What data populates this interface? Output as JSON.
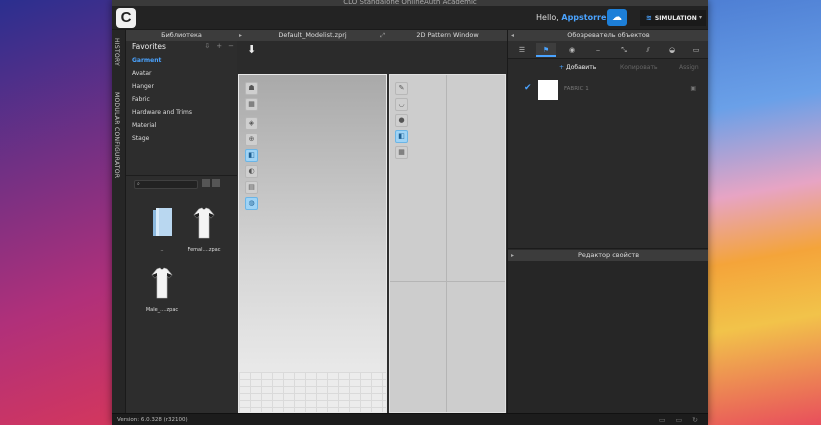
{
  "window": {
    "title": "CLO Standalone OnlineAuth Academic"
  },
  "app": {
    "logo": "C",
    "greeting": "Hello,",
    "username": "Appstorrent",
    "mode_button": "SIMULATION"
  },
  "side_tabs": {
    "history": "HISTORY",
    "modular": "MODULAR CONFIGURATOR"
  },
  "library": {
    "title": "Библиотека",
    "favorites": "Favorites",
    "items": [
      "Garment",
      "Avatar",
      "Hanger",
      "Fabric",
      "Hardware and Trims",
      "Material",
      "Stage"
    ],
    "files": [
      {
        "label": "..",
        "icon": "folder-icon"
      },
      {
        "label": "Femal....zpac",
        "icon": "tshirt-icon"
      },
      {
        "label": "Male_....zpac",
        "icon": "tshirt-icon"
      }
    ]
  },
  "viewport": {
    "title": "Default_Modelist.zprj"
  },
  "pattern": {
    "title": "2D Pattern Window"
  },
  "object_browser": {
    "title": "Обозреватель объектов",
    "add": "Добавить",
    "copy": "Копировать",
    "assign": "Assign",
    "fabric_name": "FABRIC 1"
  },
  "properties": {
    "title": "Редактор свойств"
  },
  "status": {
    "version": "Version: 6.0.328 (r32100)"
  },
  "colors": {
    "accent": "#4aa3ff",
    "cloud": "#1d7fd8"
  }
}
